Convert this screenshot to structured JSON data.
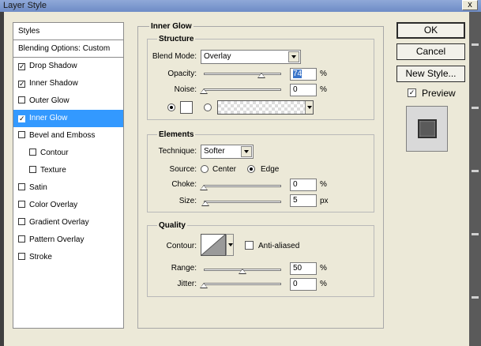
{
  "window": {
    "title": "Layer Style",
    "close_glyph": "x"
  },
  "styles_list": {
    "items": [
      {
        "label": "Styles",
        "checkbox": false,
        "checked": false,
        "selected": false,
        "indent": false
      },
      {
        "label": "Blending Options: Custom",
        "checkbox": false,
        "checked": false,
        "selected": false,
        "indent": false
      },
      {
        "label": "Drop Shadow",
        "checkbox": true,
        "checked": true,
        "selected": false,
        "indent": false
      },
      {
        "label": "Inner Shadow",
        "checkbox": true,
        "checked": true,
        "selected": false,
        "indent": false
      },
      {
        "label": "Outer Glow",
        "checkbox": true,
        "checked": false,
        "selected": false,
        "indent": false
      },
      {
        "label": "Inner Glow",
        "checkbox": true,
        "checked": true,
        "selected": true,
        "indent": false
      },
      {
        "label": "Bevel and Emboss",
        "checkbox": true,
        "checked": false,
        "selected": false,
        "indent": false
      },
      {
        "label": "Contour",
        "checkbox": true,
        "checked": false,
        "selected": false,
        "indent": true
      },
      {
        "label": "Texture",
        "checkbox": true,
        "checked": false,
        "selected": false,
        "indent": true
      },
      {
        "label": "Satin",
        "checkbox": true,
        "checked": false,
        "selected": false,
        "indent": false
      },
      {
        "label": "Color Overlay",
        "checkbox": true,
        "checked": false,
        "selected": false,
        "indent": false
      },
      {
        "label": "Gradient Overlay",
        "checkbox": true,
        "checked": false,
        "selected": false,
        "indent": false
      },
      {
        "label": "Pattern Overlay",
        "checkbox": true,
        "checked": false,
        "selected": false,
        "indent": false
      },
      {
        "label": "Stroke",
        "checkbox": true,
        "checked": false,
        "selected": false,
        "indent": false
      }
    ]
  },
  "inner_glow": {
    "title": "Inner Glow",
    "structure": {
      "title": "Structure",
      "blend_mode_label": "Blend Mode:",
      "blend_mode_value": "Overlay",
      "opacity_label": "Opacity:",
      "opacity_value": "74",
      "opacity_unit": "%",
      "opacity_fraction": 0.74,
      "noise_label": "Noise:",
      "noise_value": "0",
      "noise_unit": "%",
      "noise_fraction": 0.0,
      "color_mode": "solid"
    },
    "elements": {
      "title": "Elements",
      "technique_label": "Technique:",
      "technique_value": "Softer",
      "source_label": "Source:",
      "source_center_label": "Center",
      "source_edge_label": "Edge",
      "source_value": "Edge",
      "choke_label": "Choke:",
      "choke_value": "0",
      "choke_unit": "%",
      "choke_fraction": 0.0,
      "size_label": "Size:",
      "size_value": "5",
      "size_unit": "px",
      "size_fraction": 0.02
    },
    "quality": {
      "title": "Quality",
      "contour_label": "Contour:",
      "anti_aliased_label": "Anti-aliased",
      "anti_aliased_checked": false,
      "range_label": "Range:",
      "range_value": "50",
      "range_unit": "%",
      "range_fraction": 0.5,
      "jitter_label": "Jitter:",
      "jitter_value": "0",
      "jitter_unit": "%",
      "jitter_fraction": 0.0
    }
  },
  "buttons": {
    "ok": "OK",
    "cancel": "Cancel",
    "new_style": "New Style...",
    "preview_label": "Preview",
    "preview_checked": true
  }
}
